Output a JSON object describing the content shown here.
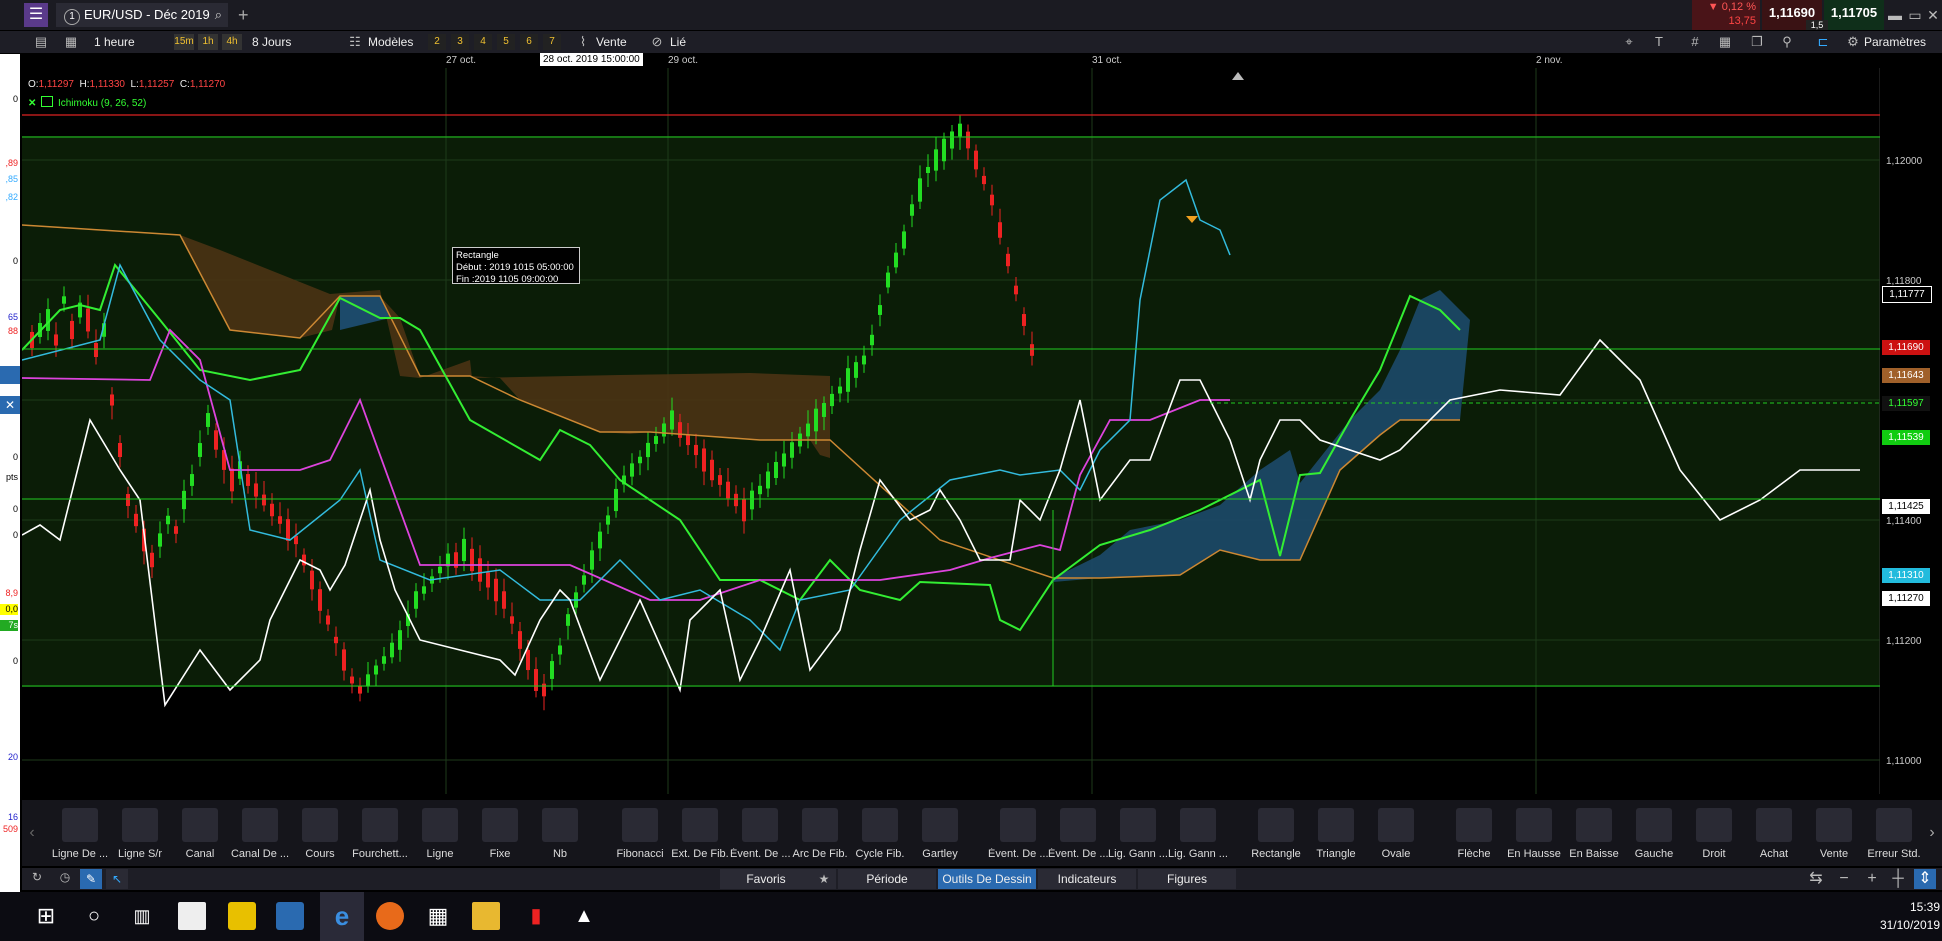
{
  "window": {
    "symbol_tab": "EUR/USD - Déc 2019",
    "tab_number": "1"
  },
  "quote": {
    "change_pct": "▼ 0,12 %",
    "change_pts": "13,75",
    "bid": "1,11690",
    "ask": "1,11705",
    "spread": "1,5"
  },
  "toolbar2": {
    "timeframe": "1 heure",
    "tf_buttons": [
      "15m",
      "1h",
      "4h"
    ],
    "range": "8 Jours",
    "models": "Modèles",
    "num_buttons": [
      "2",
      "3",
      "4",
      "5",
      "6",
      "7"
    ],
    "sell": "Vente",
    "linked": "Lié",
    "params": "Paramètres"
  },
  "dates": {
    "d1": "27 oct.",
    "d2": "28 oct. 2019 15:00:00",
    "d3": "29 oct.",
    "d4": "31 oct.",
    "d5": "2 nov."
  },
  "ohlc": {
    "o_label": "O:",
    "o": "1,11297",
    "h_label": "H:",
    "h": "1,11330",
    "l_label": "L:",
    "l": "1,11257",
    "c_label": "C:",
    "c": "1,11270"
  },
  "indicator": {
    "name": "Ichimoku (9, 26, 52)",
    "close": "✕"
  },
  "tooltip": {
    "title": "Rectangle",
    "start": "Début : 2019 1015 05:00:00",
    "end": "Fin :2019 1105 09:00:00"
  },
  "price_axis": {
    "p1": "1,12000",
    "p2": "1,11800",
    "p3": "1,11400",
    "p4": "1,11200",
    "p5": "1,11000"
  },
  "price_tags": {
    "t1": "1,11777",
    "t2": "1,11690",
    "t3": "1,11643",
    "t4": "1,11597",
    "t5": "1,11539",
    "t6": "1,11425",
    "t7": "1,11310",
    "t8": "1,11270"
  },
  "colors": {
    "bg": "#000000",
    "green_grid": "#22cc22",
    "red_line": "#dd2222",
    "up": "#22dd22",
    "down": "#ee2222",
    "tenkan": "#33bbdd",
    "kijun": "#dd44dd",
    "chikou": "#ffffff",
    "senkou_a": "#33ee33",
    "senkou_b": "#cc8833",
    "cloud_bull": "#1c4a6a",
    "cloud_bear": "#4a3314"
  },
  "tools": [
    {
      "label": "Ligne De ...",
      "icon": "line-icon"
    },
    {
      "label": "Ligne S/r",
      "icon": "sr-line-icon"
    },
    {
      "label": "Canal",
      "icon": "channel-icon"
    },
    {
      "label": "Canal De ...",
      "icon": "regression-channel-icon"
    },
    {
      "label": "Cours",
      "icon": "price-icon"
    },
    {
      "label": "Fourchett...",
      "icon": "pitchfork-icon"
    },
    {
      "label": "Ligne",
      "icon": "vertical-line-icon"
    },
    {
      "label": "Fixe",
      "icon": "fixed-line-icon"
    },
    {
      "label": "Nb",
      "icon": "text-icon"
    },
    {
      "label": "Fibonacci",
      "icon": "fibonacci-icon"
    },
    {
      "label": "Ext. De Fib.",
      "icon": "fib-extension-icon"
    },
    {
      "label": "Évent. De ...",
      "icon": "fib-fan-icon"
    },
    {
      "label": "Arc De Fib.",
      "icon": "fib-arc-icon"
    },
    {
      "label": "Cycle Fib.",
      "icon": "fib-cycle-icon"
    },
    {
      "label": "Gartley",
      "icon": "gartley-icon"
    },
    {
      "label": "Évent. De ...",
      "icon": "gann-fan-icon"
    },
    {
      "label": "Évent. De ...",
      "icon": "gann-fan2-icon"
    },
    {
      "label": "Lig. Gann ...",
      "icon": "gann-line-icon"
    },
    {
      "label": "Lig. Gann ...",
      "icon": "gann-line2-icon"
    },
    {
      "label": "Rectangle",
      "icon": "rectangle-icon"
    },
    {
      "label": "Triangle",
      "icon": "triangle-icon"
    },
    {
      "label": "Ovale",
      "icon": "oval-icon"
    },
    {
      "label": "Flèche",
      "icon": "arrow-icon"
    },
    {
      "label": "En Hausse",
      "icon": "up-arrow-icon"
    },
    {
      "label": "En Baisse",
      "icon": "down-arrow-icon"
    },
    {
      "label": "Gauche",
      "icon": "left-arrow-icon"
    },
    {
      "label": "Droit",
      "icon": "right-arrow-icon"
    },
    {
      "label": "Achat",
      "icon": "buy-arrow-icon"
    },
    {
      "label": "Vente",
      "icon": "sell-arrow-icon"
    },
    {
      "label": "Erreur Std.",
      "icon": "std-error-icon"
    }
  ],
  "bottom_tabs": [
    "Favoris",
    "Période",
    "Outils De Dessin",
    "Indicateurs",
    "Figures"
  ],
  "taskbar": {
    "time": "15:39",
    "date": "31/10/2019"
  },
  "left_strip": [
    "0",
    ",89",
    ",85",
    ",82",
    "0",
    "65",
    "88",
    "0",
    "pts",
    "0",
    "0",
    "8,9",
    "0,0",
    "7s",
    "0",
    "20",
    "16",
    "509"
  ]
}
